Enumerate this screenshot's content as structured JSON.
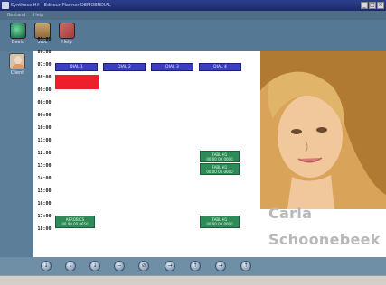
{
  "window": {
    "title": "Synthese Hi! - Editeur Planner DEMOENDIAL"
  },
  "menu": [
    "Bestand",
    "Help"
  ],
  "toolbar": [
    {
      "label": "Beeld",
      "icon": "globe-icon",
      "color": "#2f8f5f"
    },
    {
      "label": "Stoc",
      "icon": "chair-icon",
      "color": "#8b6a3c"
    },
    {
      "label": "Help",
      "icon": "book-icon",
      "color": "#a23a3a"
    }
  ],
  "sidebar": {
    "client_label": "Client"
  },
  "schedule": {
    "columns": [
      "DIAL 1",
      "DIAL 2",
      "DIAL 3",
      "DIAL 4"
    ],
    "times": [
      "05:00",
      "06:00",
      "07:00",
      "08:00",
      "09:00",
      "08:00",
      "09:00",
      "10:00",
      "11:00",
      "12:00",
      "13:00",
      "14:00",
      "15:00",
      "16:00",
      "17:00",
      "18:00"
    ],
    "appointments": [
      {
        "title": "FABL H1",
        "sub": "00 00 00 0000"
      },
      {
        "title": "FABL H1",
        "sub": "00 00 00 0000"
      },
      {
        "title": "AEROBICS",
        "sub": "00 00 00 0650"
      },
      {
        "title": "FABL H1",
        "sub": "00 00 00 0000"
      }
    ]
  },
  "client": {
    "first_name": "Carla",
    "last_name": "Schoonebeek"
  },
  "nav_icons": [
    "arrow-down-icon",
    "arrow-down-icon",
    "arrow-down-icon",
    "arrow-left-icon",
    "cancel-icon",
    "arrow-right-icon",
    "arrow-up-icon",
    "arrow-right-icon",
    "arrow-up-icon"
  ],
  "colors": {
    "header_blue": "#3b3fbf",
    "appt_green": "#2e8b57",
    "busy_red": "#ee1f2a"
  }
}
